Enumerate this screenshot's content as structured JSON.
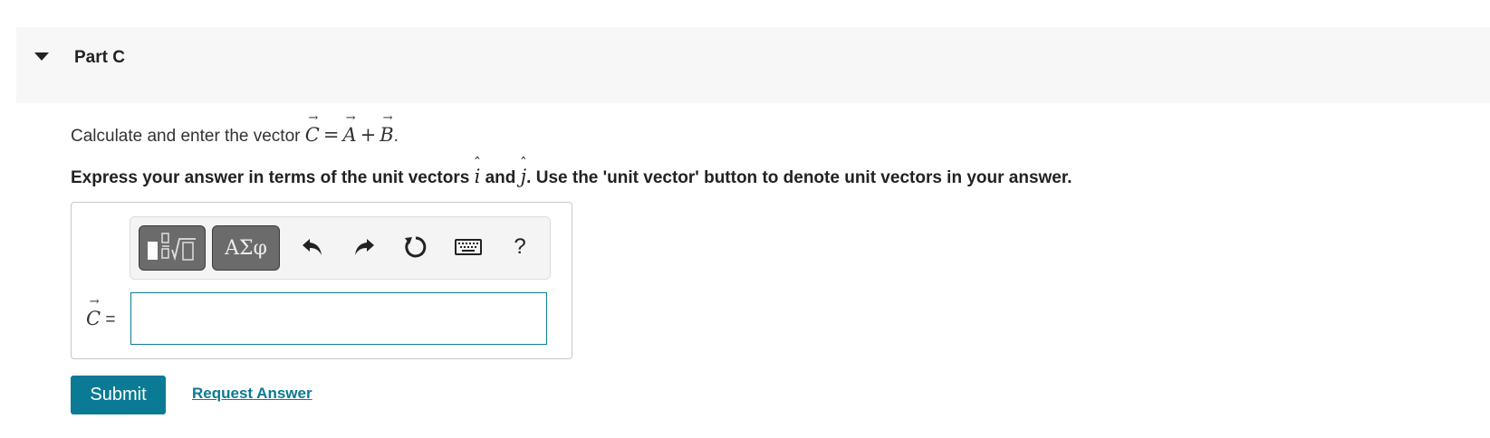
{
  "part": {
    "title": "Part C",
    "collapse_icon": "caret-down-icon"
  },
  "question": {
    "prefix": "Calculate and enter the vector ",
    "eq_C": "C",
    "eq_equals": "=",
    "eq_A": "A",
    "eq_plus": "+",
    "eq_B": "B",
    "suffix": "."
  },
  "instruction": {
    "part1": "Express your answer in terms of the unit vectors ",
    "i": "i",
    "part2": " and ",
    "j": "j",
    "part3": ". Use the 'unit vector' button to denote unit vectors in your answer."
  },
  "toolbar": {
    "templates_icon": "templates-icon",
    "greek_label": "ΑΣφ",
    "undo_icon": "undo-icon",
    "redo_icon": "redo-icon",
    "reset_icon": "reset-icon",
    "keyboard_icon": "keyboard-icon",
    "help_label": "?"
  },
  "answer": {
    "label_var": "C",
    "label_equals": "=",
    "value": "",
    "placeholder": ""
  },
  "actions": {
    "submit_label": "Submit",
    "request_label": "Request Answer"
  },
  "colors": {
    "accent": "#0b7a94",
    "header_bg": "#f7f7f7",
    "toolbar_dark": "#6b6b6b"
  }
}
